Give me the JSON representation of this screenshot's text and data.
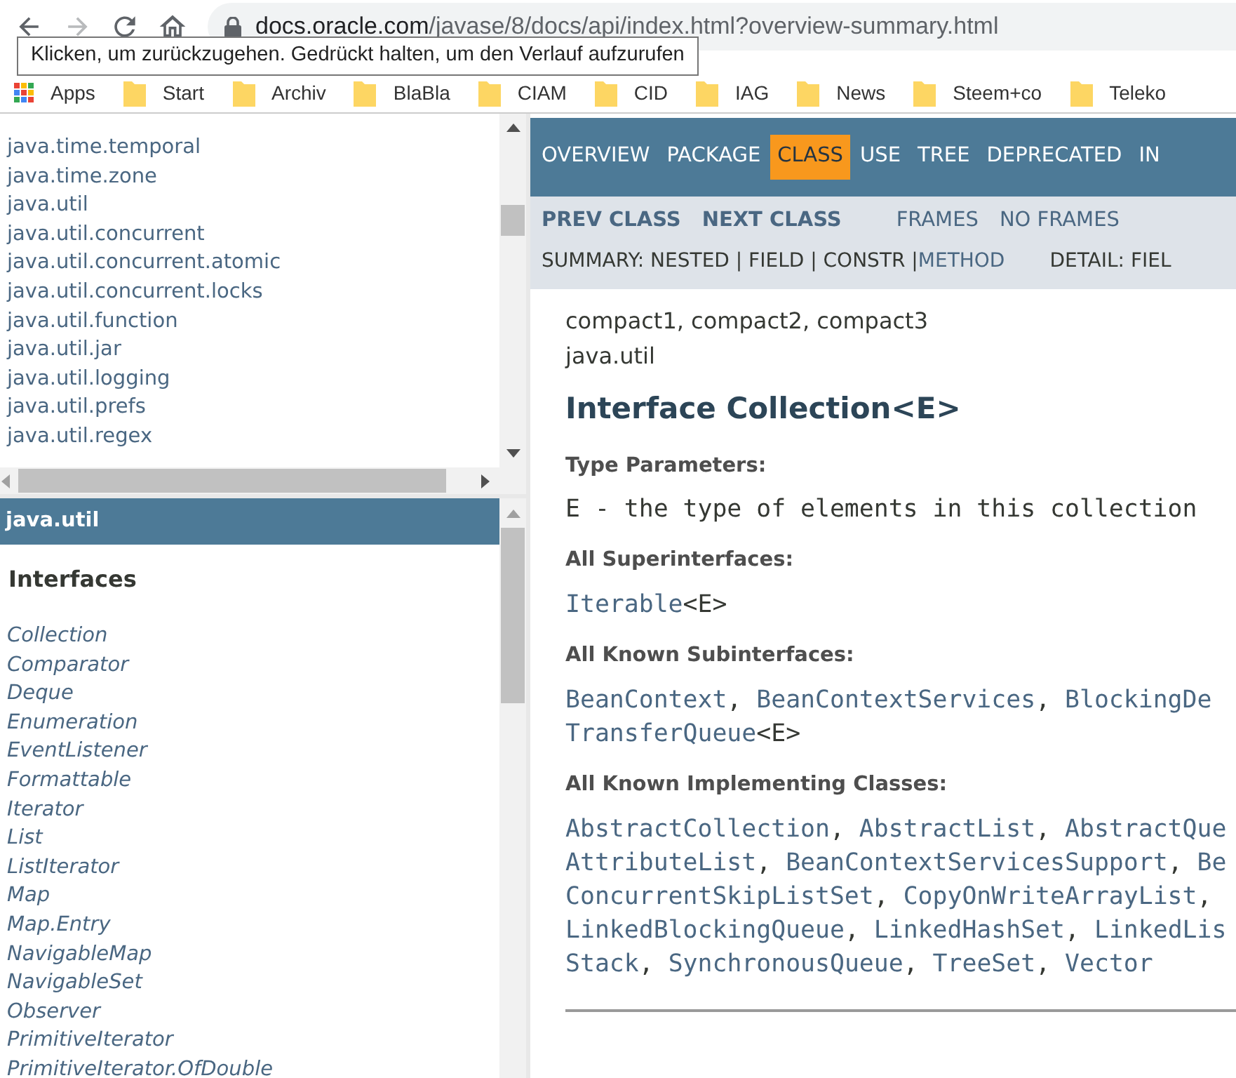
{
  "browser": {
    "nav_buttons": [
      {
        "kind": "back",
        "disabled": false
      },
      {
        "kind": "forward",
        "disabled": true
      },
      {
        "kind": "reload",
        "disabled": false
      },
      {
        "kind": "home",
        "disabled": false
      }
    ],
    "url": {
      "domain": "docs.oracle.com",
      "path": "/javase/8/docs/api/index.html?overview-summary.html"
    },
    "tooltip": "Klicken, um zurückzugehen. Gedrückt halten, um den Verlauf aufzurufen",
    "bookmarks": [
      {
        "label": "Apps",
        "kind": "apps"
      },
      {
        "label": "Start",
        "kind": "folder"
      },
      {
        "label": "Archiv",
        "kind": "folder"
      },
      {
        "label": "BlaBla",
        "kind": "folder"
      },
      {
        "label": "CIAM",
        "kind": "folder"
      },
      {
        "label": "CID",
        "kind": "folder"
      },
      {
        "label": "IAG",
        "kind": "folder"
      },
      {
        "label": "News",
        "kind": "folder"
      },
      {
        "label": "Steem+co",
        "kind": "folder"
      },
      {
        "label": "Teleko",
        "kind": "folder"
      }
    ]
  },
  "packages": [
    "java.time.temporal",
    "java.time.zone",
    "java.util",
    "java.util.concurrent",
    "java.util.concurrent.atomic",
    "java.util.concurrent.locks",
    "java.util.function",
    "java.util.jar",
    "java.util.logging",
    "java.util.prefs",
    "java.util.regex"
  ],
  "package_frame": {
    "title": "java.util",
    "heading": "Interfaces",
    "items": [
      "Collection",
      "Comparator",
      "Deque",
      "Enumeration",
      "EventListener",
      "Formattable",
      "Iterator",
      "List",
      "ListIterator",
      "Map",
      "Map.Entry",
      "NavigableMap",
      "NavigableSet",
      "Observer",
      "PrimitiveIterator",
      "PrimitiveIterator.OfDouble"
    ]
  },
  "class_frame": {
    "nav": [
      {
        "label": "OVERVIEW",
        "selected": false
      },
      {
        "label": "PACKAGE",
        "selected": false
      },
      {
        "label": "CLASS",
        "selected": true
      },
      {
        "label": "USE",
        "selected": false
      },
      {
        "label": "TREE",
        "selected": false
      },
      {
        "label": "DEPRECATED",
        "selected": false
      },
      {
        "label": "IN",
        "selected": false
      }
    ],
    "subnav": [
      {
        "label": "PREV CLASS",
        "kind": "bold"
      },
      {
        "label": "NEXT CLASS",
        "kind": "bold"
      },
      {
        "label": "FRAMES",
        "kind": "plain"
      },
      {
        "label": "NO FRAMES",
        "kind": "plain"
      }
    ],
    "summary": [
      {
        "text": "SUMMARY: NESTED | FIELD | CONSTR | ",
        "kind": "plain"
      },
      {
        "text": "METHOD",
        "kind": "link"
      }
    ],
    "detail": "DETAIL: FIEL",
    "profiles": "compact1, compact2, compact3",
    "package": "java.util",
    "title": "Interface Collection<E>",
    "sections": [
      {
        "heading": "Type Parameters:",
        "lines": [
          [
            {
              "text": "E - the type of elements in this collection",
              "kind": "plain"
            }
          ]
        ]
      },
      {
        "heading": "All Superinterfaces:",
        "lines": [
          [
            {
              "text": "Iterable",
              "kind": "link"
            },
            {
              "text": "<E>",
              "kind": "plain"
            }
          ]
        ]
      },
      {
        "heading": "All Known Subinterfaces:",
        "lines": [
          [
            {
              "text": "BeanContext",
              "kind": "link"
            },
            {
              "text": ", ",
              "kind": "plain"
            },
            {
              "text": "BeanContextServices",
              "kind": "link"
            },
            {
              "text": ", ",
              "kind": "plain"
            },
            {
              "text": "BlockingDe",
              "kind": "link"
            }
          ],
          [
            {
              "text": "TransferQueue",
              "kind": "link"
            },
            {
              "text": "<E>",
              "kind": "plain"
            }
          ]
        ]
      },
      {
        "heading": "All Known Implementing Classes:",
        "lines": [
          [
            {
              "text": "AbstractCollection",
              "kind": "link"
            },
            {
              "text": ", ",
              "kind": "plain"
            },
            {
              "text": "AbstractList",
              "kind": "link"
            },
            {
              "text": ", ",
              "kind": "plain"
            },
            {
              "text": "AbstractQue",
              "kind": "link"
            }
          ],
          [
            {
              "text": "AttributeList",
              "kind": "link"
            },
            {
              "text": ", ",
              "kind": "plain"
            },
            {
              "text": "BeanContextServicesSupport",
              "kind": "link"
            },
            {
              "text": ", ",
              "kind": "plain"
            },
            {
              "text": "Be",
              "kind": "link"
            }
          ],
          [
            {
              "text": "ConcurrentSkipListSet",
              "kind": "link"
            },
            {
              "text": ", ",
              "kind": "plain"
            },
            {
              "text": "CopyOnWriteArrayList",
              "kind": "link"
            },
            {
              "text": ",",
              "kind": "plain"
            }
          ],
          [
            {
              "text": "LinkedBlockingQueue",
              "kind": "link"
            },
            {
              "text": ", ",
              "kind": "plain"
            },
            {
              "text": "LinkedHashSet",
              "kind": "link"
            },
            {
              "text": ", ",
              "kind": "plain"
            },
            {
              "text": "LinkedLis",
              "kind": "link"
            }
          ],
          [
            {
              "text": "Stack",
              "kind": "link"
            },
            {
              "text": ", ",
              "kind": "plain"
            },
            {
              "text": "SynchronousQueue",
              "kind": "link"
            },
            {
              "text": ", ",
              "kind": "plain"
            },
            {
              "text": "TreeSet",
              "kind": "link"
            },
            {
              "text": ", ",
              "kind": "plain"
            },
            {
              "text": "Vector",
              "kind": "link"
            }
          ]
        ]
      }
    ]
  }
}
